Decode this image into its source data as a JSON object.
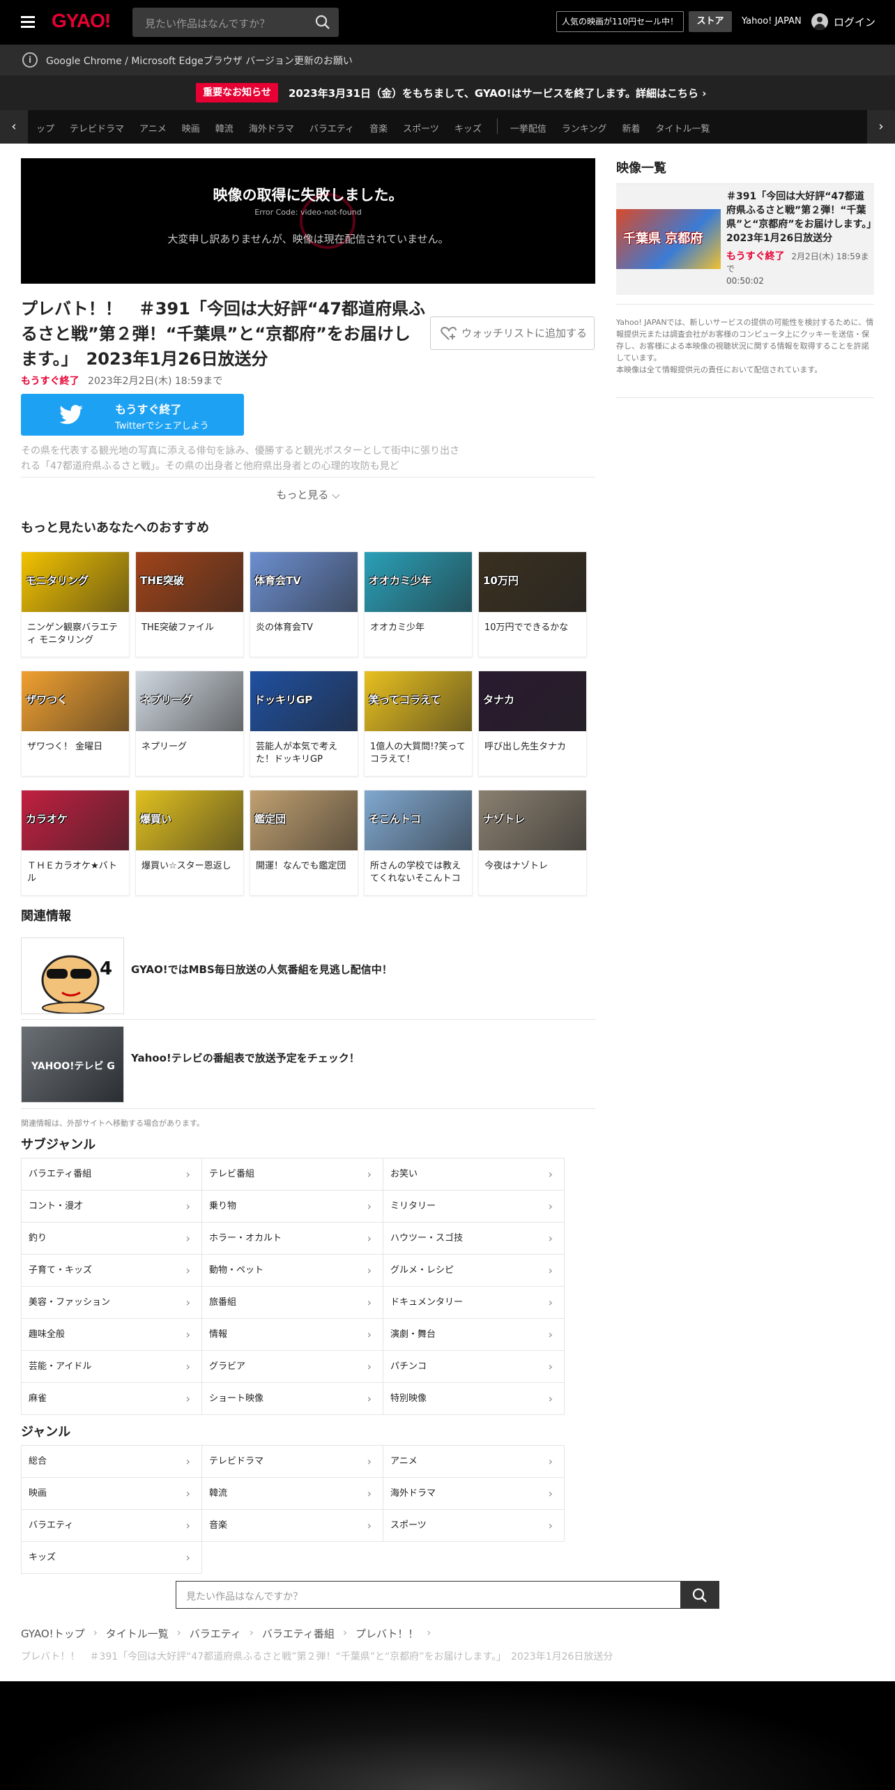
{
  "header": {
    "logo": "GYAO!",
    "search_placeholder": "見たい作品はなんですか？",
    "promo": "人気の映画が110円セール中！",
    "store": "ストア",
    "yahoo_japan": "Yahoo! JAPAN",
    "login": "ログイン"
  },
  "notices": {
    "browser": "Google Chrome / Microsoft Edgeブラウザ バージョン更新のお願い",
    "important_badge": "重要なお知らせ",
    "important_msg": "2023年3月31日（金）をもちまして、GYAO!はサービスを終了します。詳細はこちら ›"
  },
  "nav": {
    "items": [
      "ップ",
      "テレビドラマ",
      "アニメ",
      "映画",
      "韓流",
      "海外ドラマ",
      "バラエティ",
      "音楽",
      "スポーツ",
      "キッズ"
    ],
    "items2": [
      "一挙配信",
      "ランキング",
      "新着",
      "タイトル一覧"
    ]
  },
  "player": {
    "error_title": "映像の取得に失敗しました。",
    "error_code": "Error Code: video-not-found",
    "error_msg": "大変申し訳ありませんが、映像は現在配信されていません。"
  },
  "episode": {
    "title": "プレバト！！　＃391「今回は大好評“47都道府県ふるさと戦”第２弾！“千葉県”と“京都府”をお届けします。」　2023年1月26日放送分",
    "watchlist": "ウォッチリストに追加する",
    "status": "もうすぐ終了",
    "end_date": "2023年2月2日(木) 18:59まで",
    "twitter_l1": "もうすぐ終了",
    "twitter_l2": "Twitterでシェアしよう",
    "description": "その県を代表する観光地の写真に添える俳句を詠み、優勝すると観光ポスターとして街中に張り出される「47都道府県ふるさと戦」。その県の出身者と他府県出身者との心理的攻防も見ど",
    "more": "もっと見る ⌵"
  },
  "recommend": {
    "heading": "もっと見たいあなたへのおすすめ",
    "items": [
      {
        "label": "ニンゲン観察バラエティ モニタリング",
        "thumb_text": "モニタリング",
        "color": "#f2c200"
      },
      {
        "label": "THE突破ファイル",
        "thumb_text": "THE突破",
        "color": "#a0441a"
      },
      {
        "label": "炎の体育会TV",
        "thumb_text": "体育会TV",
        "color": "#6c8fd0"
      },
      {
        "label": "オオカミ少年",
        "thumb_text": "オオカミ少年",
        "color": "#2aa0b8"
      },
      {
        "label": "10万円でできるかな",
        "thumb_text": "10万円",
        "color": "#3a3020"
      },
      {
        "label": "ザワつく！ 金曜日",
        "thumb_text": "ザワつく",
        "color": "#f0a030"
      },
      {
        "label": "ネプリーグ",
        "thumb_text": "ネプリーグ",
        "color": "#d0d8e0"
      },
      {
        "label": "芸能人が本気で考えた！ドッキリGP",
        "thumb_text": "ドッキリGP",
        "color": "#2050a0"
      },
      {
        "label": "1億人の大質問!?笑ってコラえて！",
        "thumb_text": "笑ってコラえて",
        "color": "#e8c020"
      },
      {
        "label": "呼び出し先生タナカ",
        "thumb_text": "タナカ",
        "color": "#2a1a30"
      },
      {
        "label": "ＴＨＥカラオケ★バトル",
        "thumb_text": "カラオケ",
        "color": "#c02040"
      },
      {
        "label": "爆買い☆スター恩返し",
        "thumb_text": "爆買い",
        "color": "#e0c020"
      },
      {
        "label": "開運！なんでも鑑定団",
        "thumb_text": "鑑定団",
        "color": "#c0a070"
      },
      {
        "label": "所さんの学校では教えてくれないそこんトコ",
        "thumb_text": "そこんトコ",
        "color": "#80a8d0"
      },
      {
        "label": "今夜はナゾトレ",
        "thumb_text": "ナゾトレ",
        "color": "#8a8070"
      }
    ]
  },
  "related": {
    "heading": "関連情報",
    "items": [
      {
        "text": "GYAO!ではMBS毎日放送の人気番組を見逃し配信中！"
      },
      {
        "text": "Yahoo!テレビの番組表で放送予定をチェック！"
      }
    ],
    "note": "関連情報は、外部サイトへ移動する場合があります。",
    "yahoo_tv_thumb": "YAHOO!テレビ G"
  },
  "subgenre": {
    "heading": "サブジャンル",
    "items": [
      "バラエティ番組",
      "テレビ番組",
      "お笑い",
      "コント・漫才",
      "乗り物",
      "ミリタリー",
      "釣り",
      "ホラー・オカルト",
      "ハウツー・スゴ技",
      "子育て・キッズ",
      "動物・ペット",
      "グルメ・レシピ",
      "美容・ファッション",
      "旅番組",
      "ドキュメンタリー",
      "趣味全般",
      "情報",
      "演劇・舞台",
      "芸能・アイドル",
      "グラビア",
      "パチンコ",
      "麻雀",
      "ショート映像",
      "特別映像"
    ]
  },
  "genre": {
    "heading": "ジャンル",
    "items": [
      "総合",
      "テレビドラマ",
      "アニメ",
      "映画",
      "韓流",
      "海外ドラマ",
      "バラエティ",
      "音楽",
      "スポーツ",
      "キッズ"
    ]
  },
  "bottom_search": {
    "placeholder": "見たい作品はなんですか？"
  },
  "breadcrumb": {
    "items": [
      "GYAO!トップ",
      "タイトル一覧",
      "バラエティ",
      "バラエティ番組",
      "プレバト！！"
    ],
    "current": "プレバト！！　＃391「今回は大好評“47都道府県ふるさと戦”第２弾！“千葉県”と“京都府”をお届けします。」　2023年1月26日放送分"
  },
  "sidebar": {
    "heading": "映像一覧",
    "card": {
      "title": "＃391「今回は大好評“47都道府県ふるさと戦”第２弾！“千葉県”と“京都府”をお届けします。」　2023年1月26日放送分",
      "status": "もうすぐ終了",
      "date": "2月2日(木) 18:59まで",
      "duration": "00:50:02",
      "thumb_text": "千葉県 京都府"
    },
    "note": "Yahoo! JAPANでは、新しいサービスの提供の可能性を検討するために、情報提供元または調査会社がお客様のコンピュータ上にクッキーを送信・保存し、お客様による本映像の視聴状況に関する情報を取得することを許諾しています。\n本映像は全て情報提供元の責任において配信されています。"
  }
}
